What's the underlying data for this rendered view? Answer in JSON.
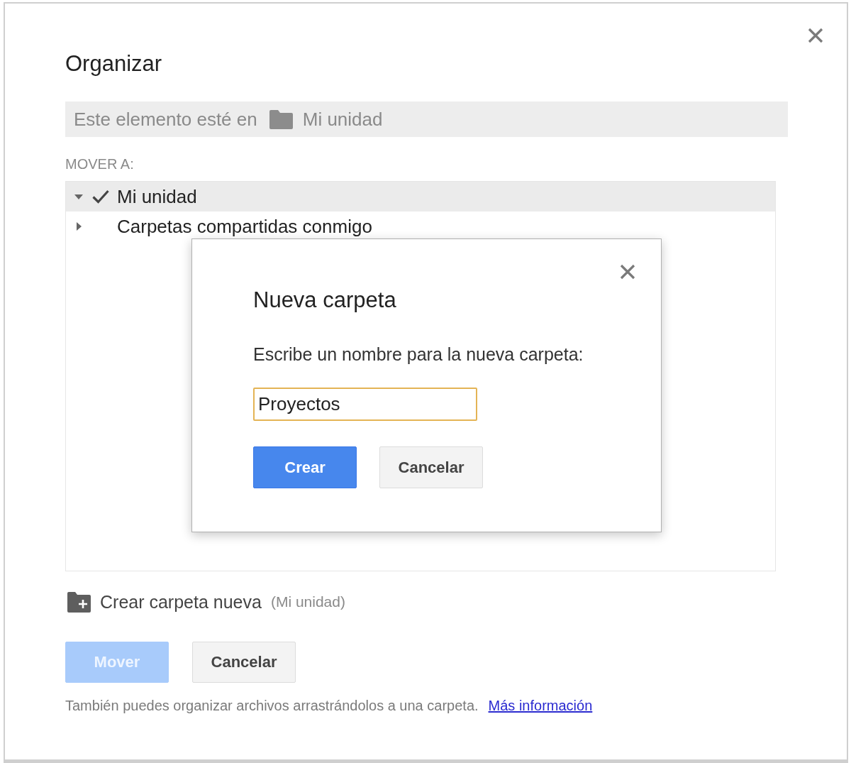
{
  "dialog": {
    "title": "Organizar"
  },
  "location": {
    "prefix": "Este elemento esté en",
    "folder": "Mi unidad"
  },
  "move_to": {
    "label": "MOVER A:"
  },
  "tree": [
    {
      "label": "Mi unidad",
      "expanded": true,
      "selected": true
    },
    {
      "label": "Carpetas compartidas conmigo",
      "expanded": false,
      "selected": false
    }
  ],
  "create_folder": {
    "label": "Crear carpeta nueva",
    "location": "(Mi unidad)"
  },
  "buttons": [
    {
      "label": "Mover",
      "kind": "primary",
      "disabled": true
    },
    {
      "label": "Cancelar",
      "kind": "secondary",
      "disabled": false
    }
  ],
  "footer": {
    "text": "También puedes organizar archivos arrastrándolos a una carpeta.",
    "link": "Más información"
  },
  "modal": {
    "title": "Nueva carpeta",
    "prompt": "Escribe un nombre para la nueva carpeta:",
    "input": {
      "value": "Proyectos",
      "focused": true
    },
    "buttons": [
      {
        "label": "Crear",
        "kind": "primary",
        "disabled": false
      },
      {
        "label": "Cancelar",
        "kind": "secondary",
        "disabled": false
      }
    ]
  }
}
